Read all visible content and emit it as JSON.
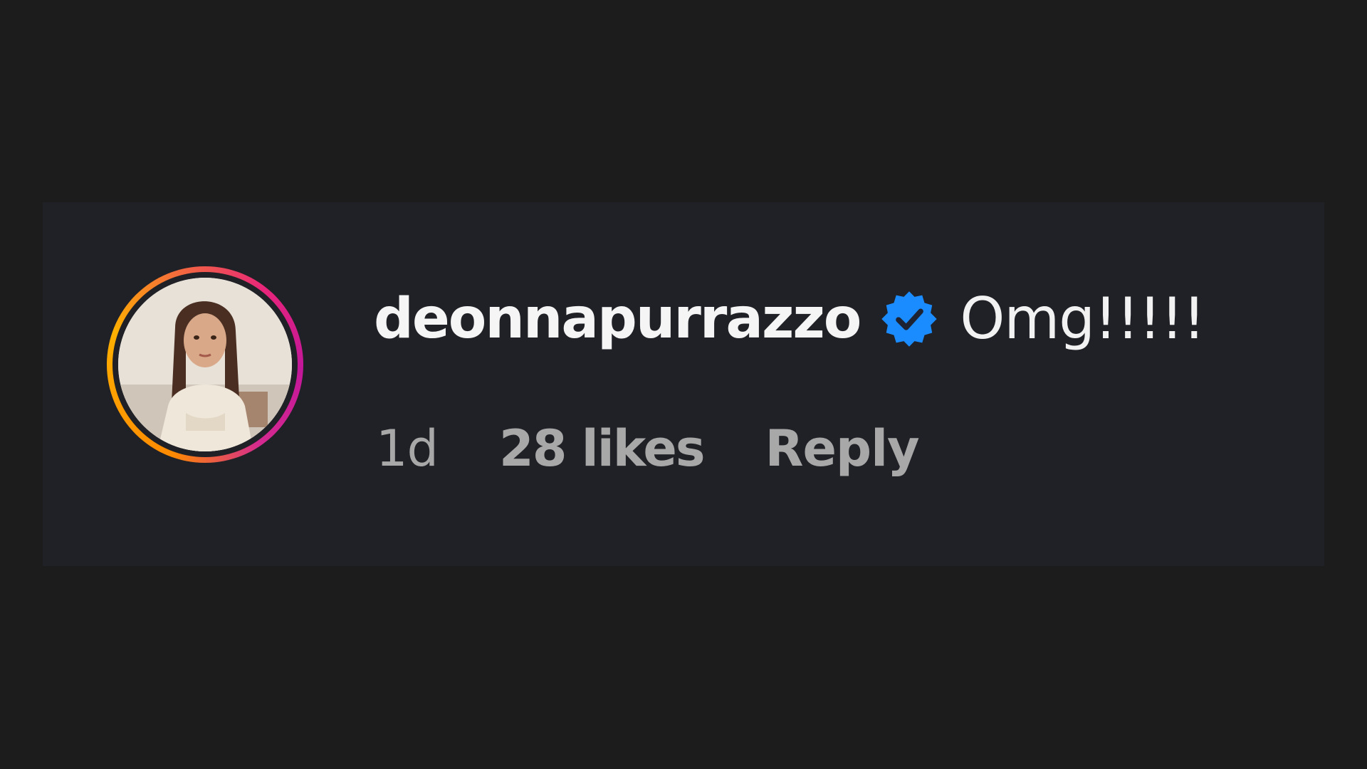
{
  "comment": {
    "username": "deonnapurrazzo",
    "verified_icon": "verified-badge-icon",
    "text": "Omg!!!!!",
    "time": "1d",
    "likes": "28 likes",
    "reply_label": "Reply"
  },
  "avatar": {
    "icon": "profile-photo",
    "ring_colors": [
      "#ff8a00",
      "#ffb000",
      "#e8257a",
      "#c3179a"
    ]
  },
  "colors": {
    "background": "#1c1c1c",
    "card": "#202126",
    "username": "#f5f5f5",
    "meta": "#a8a8a8",
    "verified": "#1a8cff"
  }
}
